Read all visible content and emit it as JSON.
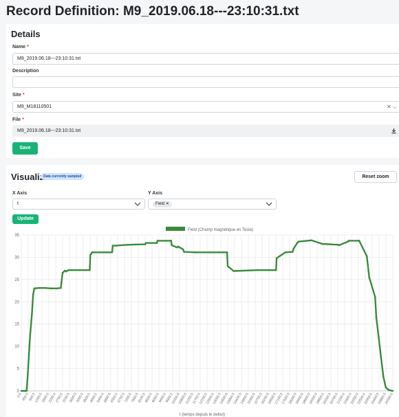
{
  "page": {
    "title": "Record Definition: M9_2019.06.18---23:10:31.txt"
  },
  "details": {
    "title": "Details",
    "name": {
      "label": "Name",
      "required": "*",
      "value": "M9_2019.06.18---23:10:31.txt"
    },
    "description": {
      "label": "Description",
      "value": ""
    },
    "site": {
      "label": "Site",
      "required": "*",
      "value": "M9_M18110501",
      "icons": "✕ ⌵"
    },
    "file": {
      "label": "File",
      "required": "*",
      "value": "M9_2019.06.18---23:10:31.txt",
      "icon": "download-icon"
    },
    "save_label": "Save"
  },
  "visualize": {
    "title": "Visualize",
    "badge": "Data currently sampled",
    "reset_label": "Reset zoom",
    "x_axis": {
      "label": "X Axis",
      "value": "t"
    },
    "y_axis": {
      "label": "Y Axis",
      "chip": "Field",
      "chip_remove": "✕"
    },
    "update_label": "Update"
  },
  "colors": {
    "accent": "#19b377",
    "series": "#3a8a3a",
    "badge_bg": "#cfe3fb"
  },
  "chart_data": {
    "type": "line",
    "legend": "Field (Champ magnétique en Tesla)",
    "legend_position": "top-center",
    "xlabel": "t (temps depuis le debut)",
    "ylabel": "",
    "ylim": [
      0,
      35
    ],
    "grid": true,
    "y_ticks": [
      0,
      5,
      10,
      15,
      20,
      25,
      30,
      35
    ],
    "x_tick_labels": [
      "0.0",
      "450.0",
      "900.0",
      "1350.0",
      "1800.0",
      "2250.0",
      "2700.0",
      "3150.0",
      "3600.0",
      "4050.0",
      "4500.0",
      "4950.0",
      "5400.0",
      "5850.0",
      "6300.0",
      "6750.0",
      "7200.0",
      "7650.0",
      "8100.0",
      "8550.0",
      "9000.0",
      "9450.0",
      "9900.0",
      "10350.0",
      "10800.0",
      "11250.0",
      "11700.0",
      "12150.0",
      "12600.0",
      "13050.0",
      "13500.0",
      "13950.0",
      "14400.0",
      "14850.0",
      "15300.0",
      "15750.0",
      "16200.0",
      "16650.0",
      "17100.0",
      "17550.0",
      "18000.0",
      "18450.0",
      "18900.0",
      "19350.0",
      "19800.0",
      "20250.0",
      "20700.0",
      "21150.0",
      "21600.0",
      "22050.0",
      "22500.0",
      "22950.0",
      "23400.0",
      "23850.0",
      "24300.0"
    ],
    "x": [
      0,
      150,
      300,
      450,
      550,
      650,
      750,
      900,
      1000,
      1100,
      1500,
      2000,
      2500,
      3000,
      3350,
      3500,
      3700,
      3800,
      4000,
      5000,
      5800,
      5850,
      6000,
      7000,
      7700,
      7750,
      8000,
      9000,
      10500,
      10550,
      11500,
      11550,
      12700,
      12750,
      13200,
      13300,
      13700,
      13800,
      14700,
      16800,
      17450,
      17500,
      18000,
      20000,
      20950,
      21000,
      21600,
      21650,
      22400,
      22450,
      23000,
      23100,
      23400,
      23500,
      24600,
      25500,
      26900,
      26950,
      27700,
      27750,
      28600,
      28650,
      29300,
      29500,
      30000,
      30100,
      30300,
      30500,
      30700,
      30900,
      31100,
      31300,
      31500
    ],
    "values": [
      0,
      0,
      0,
      0,
      3.8,
      8.2,
      12.7,
      17.2,
      21.6,
      23,
      23.1,
      23.1,
      23,
      23,
      23.1,
      26.5,
      27,
      26.8,
      27.1,
      27.1,
      27.1,
      30.5,
      31.1,
      31.1,
      31.1,
      32.6,
      32.6,
      32.8,
      32.9,
      33.2,
      33.2,
      33.7,
      33.7,
      32.7,
      32.2,
      32.4,
      31.8,
      31.2,
      31.1,
      31.1,
      31.1,
      28,
      26.9,
      27.1,
      27.1,
      27.1,
      27.1,
      29.8,
      31.1,
      31.1,
      31.2,
      32,
      33.2,
      33.5,
      33.8,
      33,
      32.8,
      32.7,
      33.5,
      33.7,
      33.7,
      33.7,
      30.2,
      25.5,
      21.1,
      16.5,
      12.1,
      7.5,
      3.2,
      0.8,
      0.3,
      0.1,
      0
    ]
  }
}
